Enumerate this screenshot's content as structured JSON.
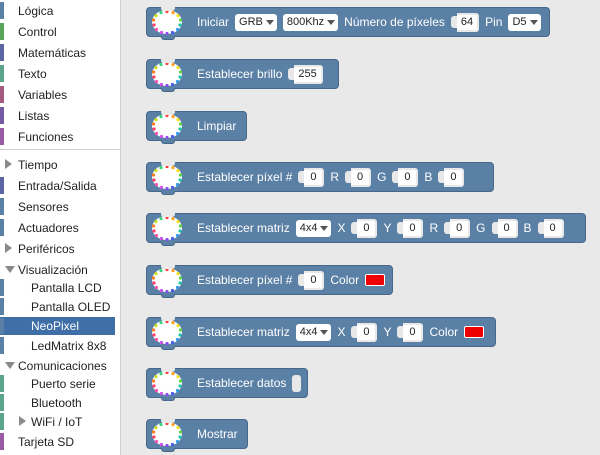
{
  "toolbox": {
    "items": [
      {
        "label": "Lógica",
        "color": "#5b80a5"
      },
      {
        "label": "Control",
        "color": "#5ba55b"
      },
      {
        "label": "Matemáticas",
        "color": "#5b67a5"
      },
      {
        "label": "Texto",
        "color": "#5ba58c"
      },
      {
        "label": "Variables",
        "color": "#a55b80"
      },
      {
        "label": "Listas",
        "color": "#745ba5"
      },
      {
        "label": "Funciones",
        "color": "#995ba5"
      },
      {
        "label": "Tiempo",
        "color": "#5ba55b"
      },
      {
        "label": "Entrada/Salida",
        "color": "#5b67a5"
      },
      {
        "label": "Sensores",
        "color": "#5b80a5"
      },
      {
        "label": "Actuadores",
        "color": "#5b80a5"
      },
      {
        "label": "Periféricos",
        "color": "#5b80a5"
      },
      {
        "label": "Visualización",
        "color": "#5b80a5"
      },
      {
        "label": "Pantalla LCD",
        "color": "#5b80a5"
      },
      {
        "label": "Pantalla OLED",
        "color": "#5b80a5"
      },
      {
        "label": "NeoPixel",
        "color": "#5b80a5"
      },
      {
        "label": "LedMatrix 8x8",
        "color": "#5b80a5"
      },
      {
        "label": "Comunicaciones",
        "color": "#5ba58c"
      },
      {
        "label": "Puerto serie",
        "color": "#5ba58c"
      },
      {
        "label": "Bluetooth",
        "color": "#5ba58c"
      },
      {
        "label": "WiFi / IoT",
        "color": "#5ba58c"
      },
      {
        "label": "Tarjeta SD",
        "color": "#995ba5"
      }
    ]
  },
  "logo_text": [
    "Neo",
    "Pixel"
  ],
  "blocks": {
    "init": {
      "label": "Iniciar",
      "order": "GRB",
      "freq": "800Khz",
      "count_label": "Número de píxeles",
      "count": "64",
      "pin_label": "Pin",
      "pin": "D5"
    },
    "brightness": {
      "label": "Establecer brillo",
      "value": "255"
    },
    "clear": {
      "label": "Limpiar"
    },
    "pixel_rgb": {
      "label": "Establecer píxel #",
      "index": "0",
      "r_label": "R",
      "r": "0",
      "g_label": "G",
      "g": "0",
      "b_label": "B",
      "b": "0"
    },
    "matrix_rgb": {
      "label": "Establecer matriz",
      "size": "4x4",
      "x_label": "X",
      "x": "0",
      "y_label": "Y",
      "y": "0",
      "r_label": "R",
      "r": "0",
      "g_label": "G",
      "g": "0",
      "b_label": "B",
      "b": "0"
    },
    "pixel_color": {
      "label": "Establecer píxel #",
      "index": "0",
      "color_label": "Color",
      "color": "#ee0000"
    },
    "matrix_color": {
      "label": "Establecer matriz",
      "size": "4x4",
      "x_label": "X",
      "x": "0",
      "y_label": "Y",
      "y": "0",
      "color_label": "Color",
      "color": "#ee0000"
    },
    "data": {
      "label": "Establecer datos"
    },
    "show": {
      "label": "Mostrar"
    }
  },
  "colors": {
    "block": "#5b80a5",
    "selected": "#3f6fa6",
    "workspace": "#e9e9e9"
  }
}
